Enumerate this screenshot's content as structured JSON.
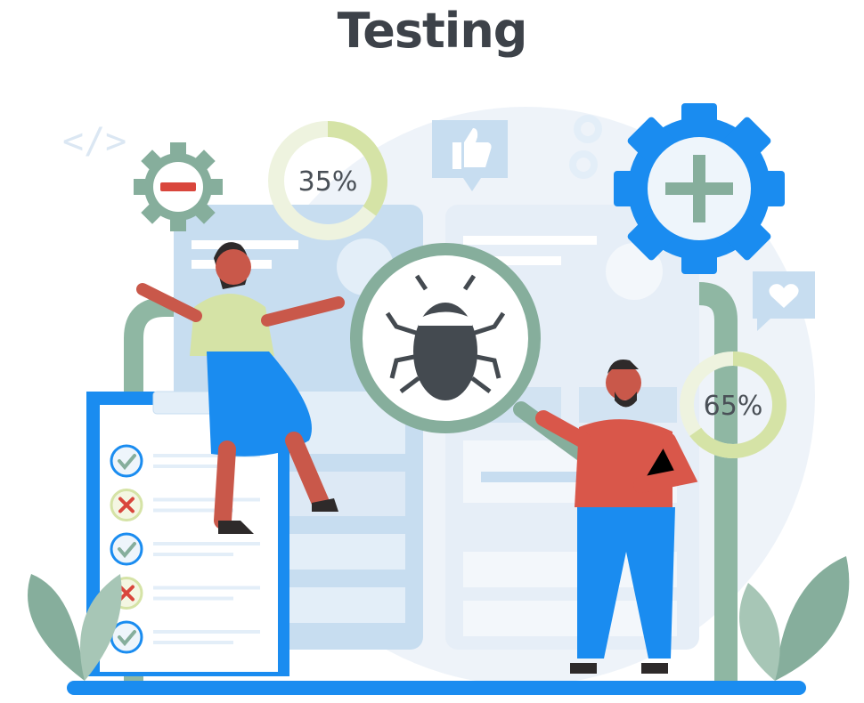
{
  "title": "Testing",
  "code_symbol": "</>",
  "progress": {
    "left_donut_label": "35%",
    "left_donut_value": 35,
    "right_donut_label": "65%",
    "right_donut_value": 65
  },
  "checklist": [
    {
      "status": "pass",
      "icon": "check-icon"
    },
    {
      "status": "fail",
      "icon": "cross-icon"
    },
    {
      "status": "pass",
      "icon": "check-icon"
    },
    {
      "status": "fail",
      "icon": "cross-icon"
    },
    {
      "status": "pass",
      "icon": "check-icon"
    }
  ],
  "icons": [
    "code-icon",
    "gear-minus-icon",
    "thumbs-up-icon",
    "gear-icon",
    "gear-plus-icon",
    "heart-icon",
    "magnifier-icon",
    "bug-icon",
    "plant-icon"
  ],
  "colors": {
    "title": "#3d4249",
    "accent_blue": "#1a8cf0",
    "sage_green": "#86ae9c",
    "light_blue": "#c7ddf0",
    "pale_blue": "#eaf1f8",
    "red": "#d9463c",
    "donut": "#d5e3a6"
  }
}
